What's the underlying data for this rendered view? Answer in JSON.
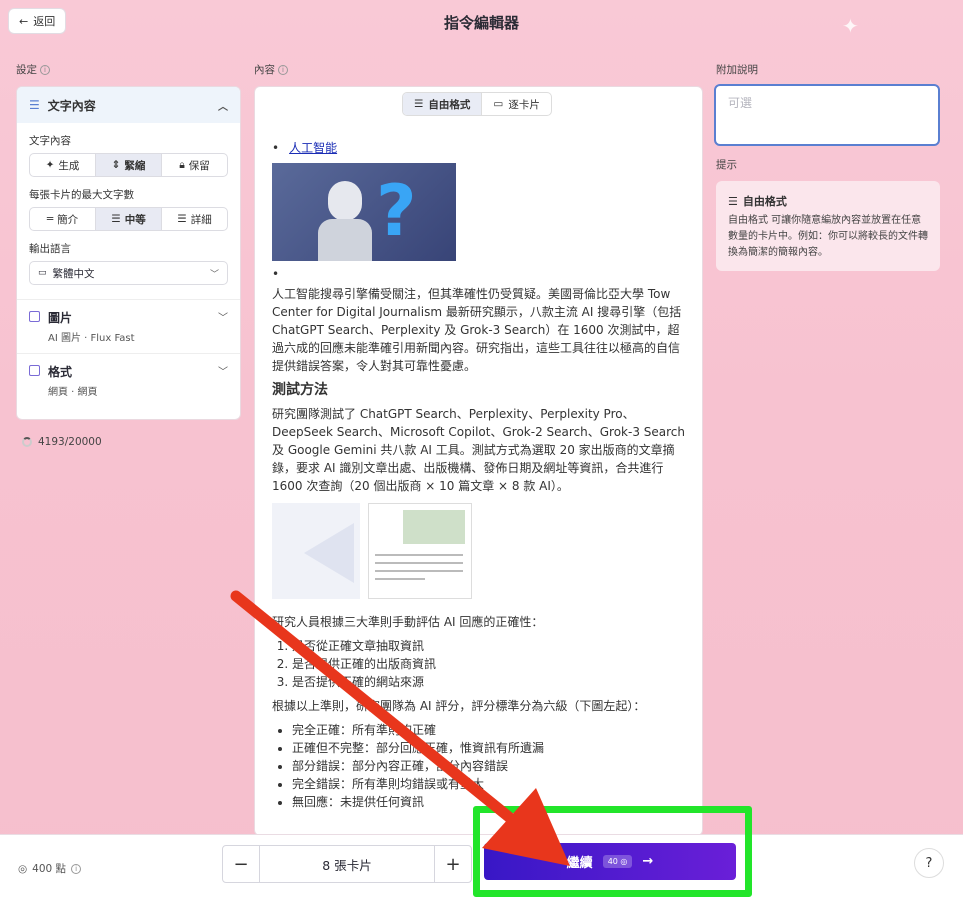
{
  "header": {
    "back_label": "返回",
    "title": "指令編輯器"
  },
  "settings": {
    "label": "設定",
    "text_section": {
      "title": "文字內容",
      "content_label": "文字內容",
      "content_options": [
        "生成",
        "緊縮",
        "保留"
      ],
      "content_selected": "緊縮",
      "maxlen_label": "每張卡片的最大文字數",
      "maxlen_options": [
        "簡介",
        "中等",
        "詳細"
      ],
      "maxlen_selected": "中等",
      "lang_label": "輸出語言",
      "lang_value": "繁體中文"
    },
    "images": {
      "title": "圖片",
      "sub": "AI 圖片 · Flux Fast"
    },
    "format": {
      "title": "格式",
      "sub": "網頁 · 網頁"
    },
    "char_count": "4193/20000"
  },
  "content": {
    "label": "內容",
    "tabs": [
      "自由格式",
      "逐卡片"
    ],
    "active_tab": "自由格式",
    "link": "人工智能",
    "para1": "人工智能搜尋引擎備受關注，但其準確性仍受質疑。美國哥倫比亞大學 Tow Center for Digital Journalism 最新研究顯示，八款主流 AI 搜尋引擎（包括 ChatGPT Search、Perplexity 及 Grok-3 Search）在 1600 次測試中，超過六成的回應未能準確引用新聞內容。研究指出，這些工具往往以極高的自信提供錯誤答案，令人對其可靠性憂慮。",
    "heading": "測試方法",
    "para2": "研究團隊測試了 ChatGPT Search、Perplexity、Perplexity Pro、DeepSeek Search、Microsoft Copilot、Grok-2 Search、Grok-3 Search 及 Google Gemini 共八款 AI 工具。測試方式為選取 20 家出版商的文章摘錄，要求 AI 識別文章出處、出版機構、發佈日期及網址等資訊，合共進行 1600 次查詢（20 個出版商 × 10 篇文章 × 8 款 AI）。",
    "para3": "研究人員根據三大準則手動評估 AI 回應的正確性：",
    "criteria": [
      "是否從正確文章抽取資訊",
      "是否提供正確的出版商資訊",
      "是否提供正確的網站來源"
    ],
    "para4": "根據以上準則，研究團隊為 AI 評分，評分標準分為六級（下圖左起）：",
    "grades": [
      "完全正確：所有準則均正確",
      "正確但不完整：部分回應正確，惟資訊有所遺漏",
      "部分錯誤：部分內容正確，部分內容錯誤",
      "完全錯誤：所有準則均錯誤或有重大",
      "無回應：未提供任何資訊"
    ]
  },
  "extra": {
    "label": "附加說明",
    "placeholder": "可選"
  },
  "hint": {
    "label": "提示",
    "title": "自由格式",
    "text": "自由格式 可讓你隨意編放內容並放置在任意數量的卡片中。例如：你可以將較長的文件轉換為簡潔的簡報內容。"
  },
  "footer": {
    "points": "400 點",
    "card_count": "8 張卡片",
    "continue_label": "繼續",
    "cost": "40"
  },
  "colors": {
    "accent": "#4a1fd0",
    "highlight": "#22e52a",
    "annotation_arrow": "#e8361c"
  }
}
